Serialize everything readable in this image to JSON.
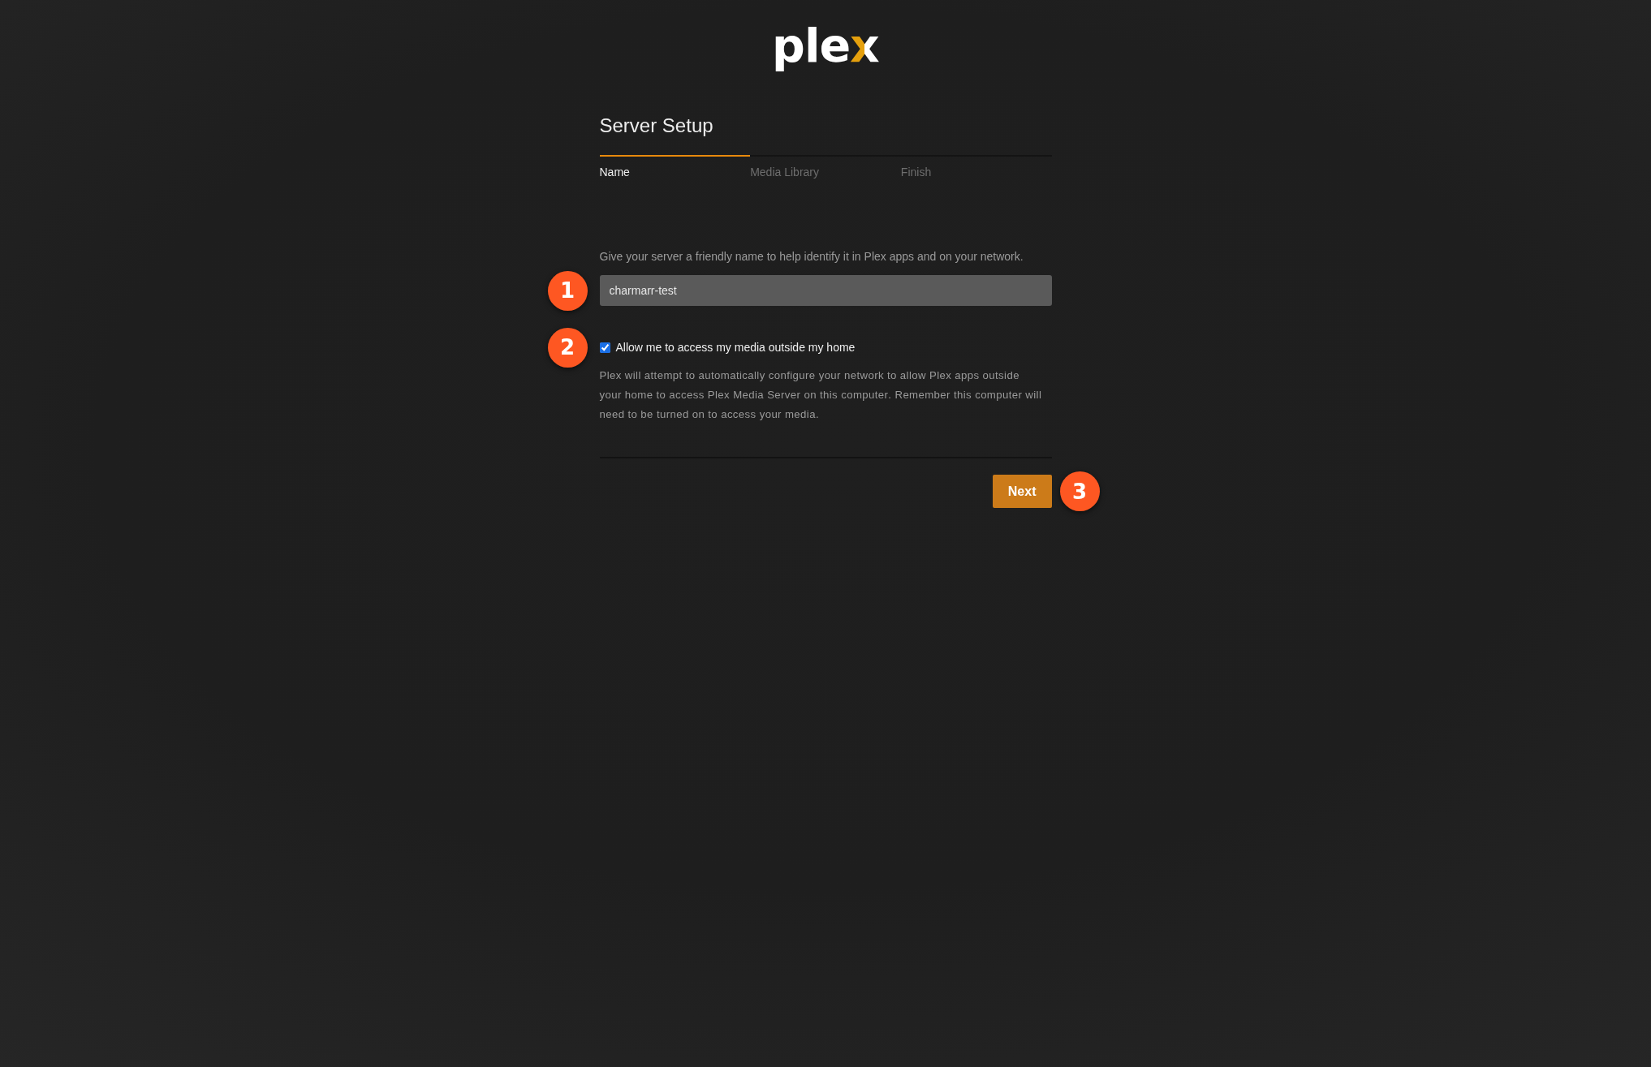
{
  "logo": {
    "text": "plex"
  },
  "title": "Server Setup",
  "steps": [
    {
      "label": "Name",
      "selected": true
    },
    {
      "label": "Media Library",
      "selected": false
    },
    {
      "label": "Finish",
      "selected": false
    }
  ],
  "server_name": {
    "description": "Give your server a friendly name to help identify it in Plex apps and on your network.",
    "value": "charmarr-test"
  },
  "remote_access": {
    "label": "Allow me to access my media outside my home",
    "checked": true,
    "description": "Plex will attempt to automatically configure your network to allow Plex apps outside your home to access Plex Media Server on this computer. Remember this computer will need to be turned on to access your media."
  },
  "next_button": {
    "label": "Next"
  },
  "markers": [
    {
      "label": "1"
    },
    {
      "label": "2"
    },
    {
      "label": "3"
    }
  ]
}
